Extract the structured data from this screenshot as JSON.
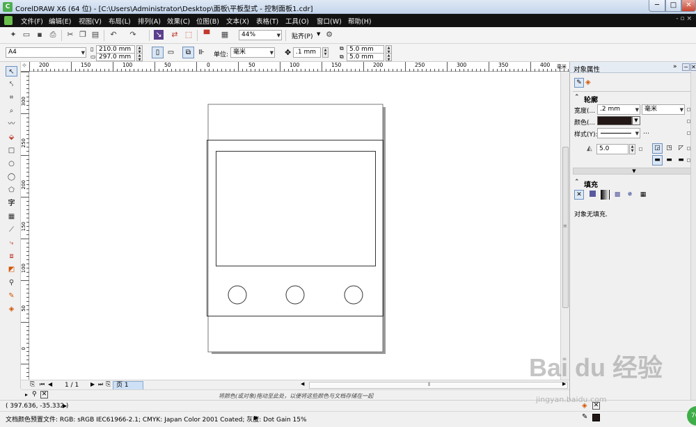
{
  "window": {
    "app_icon_letter": "C",
    "title": "CorelDRAW X6 (64 位) - [C:\\Users\\Administrator\\Desktop\\面板\\平板型式 - 控制面板1.cdr]",
    "min": "─",
    "max": "□",
    "close": "✕"
  },
  "menu": {
    "items": [
      "文件(F)",
      "编辑(E)",
      "视图(V)",
      "布局(L)",
      "排列(A)",
      "效果(C)",
      "位图(B)",
      "文本(X)",
      "表格(T)",
      "工具(O)",
      "窗口(W)",
      "帮助(H)"
    ],
    "right_controls": "- ▫ ×"
  },
  "toolbar": {
    "zoom": "44%",
    "snap_label": "贴齐(P)"
  },
  "property_bar": {
    "page_size": "A4",
    "width": "210.0 mm",
    "height": "297.0 mm",
    "units_label": "单位:",
    "units_value": "毫米",
    "nudge": ".1 mm",
    "dup_x": "5.0 mm",
    "dup_y": "5.0 mm"
  },
  "ruler": {
    "unit_hint": "毫米",
    "top_ticks": [
      "200",
      "150",
      "100",
      "50",
      "0",
      "50",
      "100",
      "150",
      "200",
      "250",
      "300",
      "350",
      "400"
    ],
    "left_ticks": [
      "300",
      "250",
      "200",
      "150",
      "100",
      "50",
      "0"
    ]
  },
  "page_nav": {
    "counter": "1 / 1",
    "tab": "页 1"
  },
  "palette": {
    "hint": "将颜色(或对象)拖动至此处，以便将这些颜色与文档存储在一起"
  },
  "status": {
    "coords": "( 397.636, -35.332 )",
    "color_profile": "文档颜色预置文件: RGB: sRGB IEC61966-2.1; CMYK: Japan Color 2001 Coated; 灰度: Dot Gain 15%"
  },
  "docker": {
    "title": "对象属性",
    "outline": {
      "heading": "轮廓",
      "width_label": "宽度(...",
      "width_value": ".2 mm",
      "width_unit": "毫米",
      "color_label": "颜色(...",
      "style_label": "样式(Y):",
      "miter_value": "5.0",
      "color": "#231815"
    },
    "fill": {
      "heading": "填充",
      "no_fill_text": "对象无填充."
    }
  },
  "watermark": {
    "main": "Bai du 经验",
    "sub": "jingyan.baidu.com"
  }
}
